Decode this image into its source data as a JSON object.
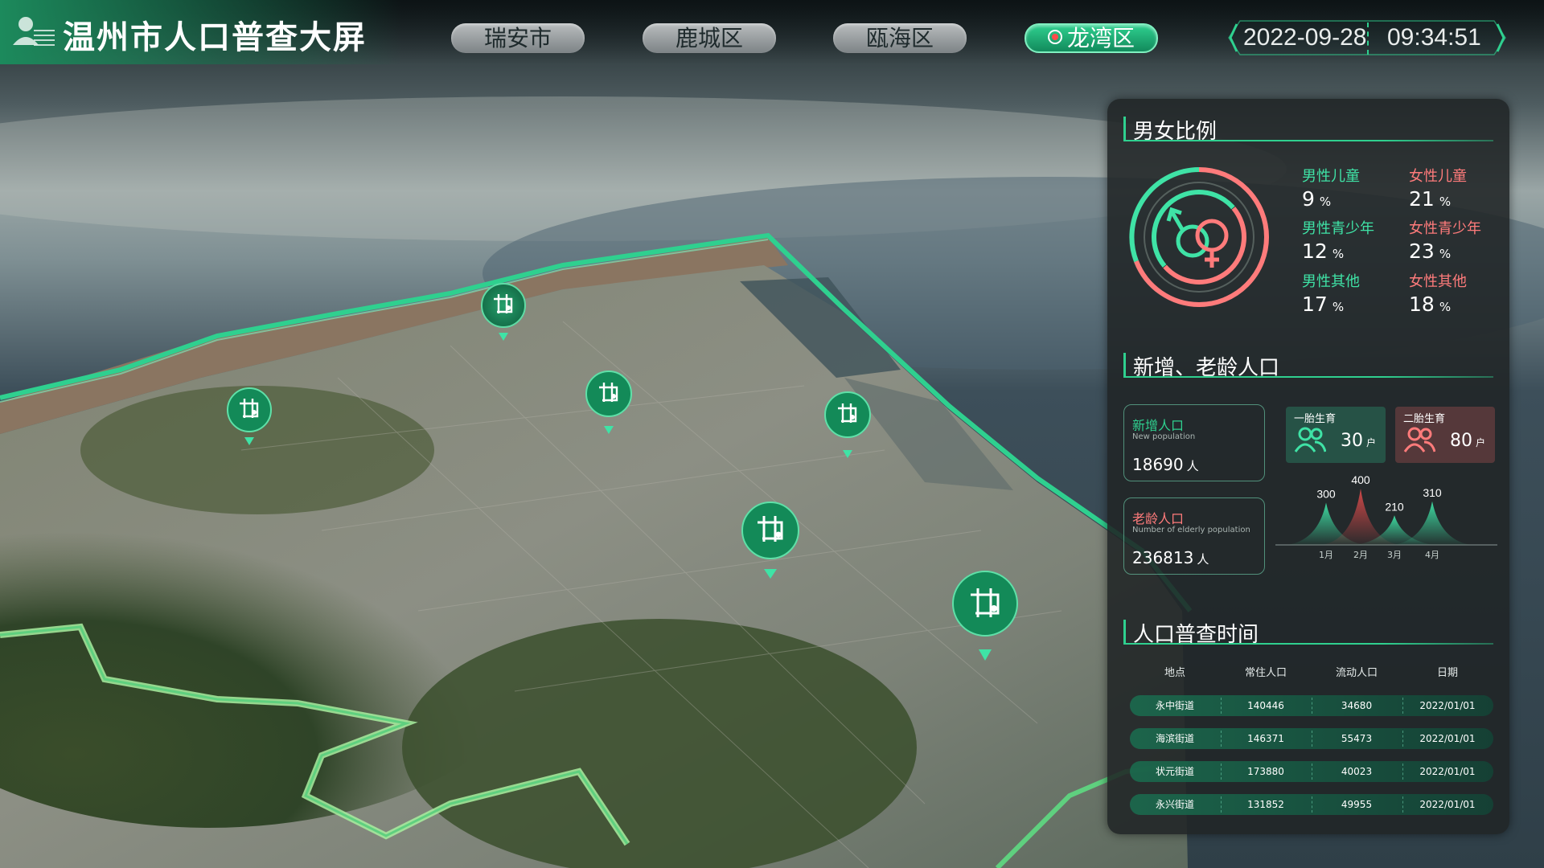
{
  "header": {
    "title": "温州市人口普查大屏",
    "tabs": [
      {
        "label": "瑞安市",
        "active": false
      },
      {
        "label": "鹿城区",
        "active": false
      },
      {
        "label": "瓯海区",
        "active": false
      },
      {
        "label": "龙湾区",
        "active": true
      }
    ],
    "date": "2022-09-28",
    "time": "09:34:51"
  },
  "colors": {
    "accent": "#2fd08f",
    "female": "#ff7b7b",
    "male": "#3fe3a6"
  },
  "gender": {
    "title": "男女比例",
    "stats": [
      {
        "label": "男性儿童",
        "value": "9",
        "unit": "%"
      },
      {
        "label": "女性儿童",
        "value": "21",
        "unit": "%"
      },
      {
        "label": "男性青少年",
        "value": "12",
        "unit": "%"
      },
      {
        "label": "女性青少年",
        "value": "23",
        "unit": "%"
      },
      {
        "label": "男性其他",
        "value": "17",
        "unit": "%"
      },
      {
        "label": "女性其他",
        "value": "18",
        "unit": "%"
      }
    ]
  },
  "population": {
    "title": "新增、老龄人口",
    "new": {
      "label": "新增人口",
      "sub": "New population",
      "value": "18690",
      "unit": "人"
    },
    "elderly": {
      "label": "老龄人口",
      "sub": "Number of elderly population",
      "value": "236813",
      "unit": "人"
    },
    "births": [
      {
        "label": "一胎生育",
        "value": "30",
        "unit": "户"
      },
      {
        "label": "二胎生育",
        "value": "80",
        "unit": "户"
      }
    ]
  },
  "chart_data": {
    "type": "area",
    "categories": [
      "1月",
      "2月",
      "3月",
      "4月"
    ],
    "values": [
      300,
      400,
      210,
      310
    ],
    "ylim": [
      0,
      400
    ]
  },
  "census": {
    "title": "人口普查时间",
    "columns": [
      "地点",
      "常住人口",
      "流动人口",
      "日期"
    ],
    "rows": [
      [
        "永中街道",
        "140446",
        "34680",
        "2022/01/01"
      ],
      [
        "海滨街道",
        "146371",
        "55473",
        "2022/01/01"
      ],
      [
        "状元街道",
        "173880",
        "40023",
        "2022/01/01"
      ],
      [
        "永兴街道",
        "131852",
        "49955",
        "2022/01/01"
      ]
    ]
  },
  "map": {
    "markers": [
      {
        "icon": "marker-icon"
      },
      {
        "icon": "marker-icon"
      },
      {
        "icon": "marker-icon"
      },
      {
        "icon": "marker-icon"
      },
      {
        "icon": "marker-icon"
      },
      {
        "icon": "marker-icon"
      }
    ]
  }
}
